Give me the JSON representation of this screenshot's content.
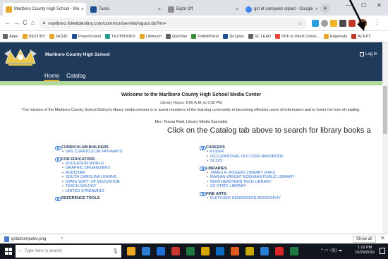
{
  "browser": {
    "tabs": [
      {
        "label": "Marlboro County High School - Ma",
        "color": "#e8a62a"
      },
      {
        "label": "Tasks",
        "color": "#1d4f91"
      },
      {
        "label": "Eight Off",
        "color": "#8e8e8e"
      },
      {
        "label": "girl at computer clipart - Google",
        "color": "#4285f4"
      }
    ],
    "tab_close": "×",
    "new_tab": "+",
    "window_controls": {
      "minimize": "—",
      "maximize": "☐",
      "close": "✕"
    },
    "nav": {
      "back": "←",
      "forward": "→",
      "reload": "C",
      "home": "⌂"
    },
    "url": "marlboro.follettdestiny.com/common/servlet/logout.do?lm=",
    "star": "☆",
    "menu": "⋮"
  },
  "bookmarks": [
    {
      "label": "Apps",
      "color": "#5f6368"
    },
    {
      "label": "DESTINY",
      "color": "#e8a62a"
    },
    {
      "label": "MCHS",
      "color": "#e8a62a"
    },
    {
      "label": "PowerSchool",
      "color": "#1d4f91"
    },
    {
      "label": "TEXTBOOKS",
      "color": "#2a9d8f"
    },
    {
      "label": "Lifetouch",
      "color": "#e8a62a"
    },
    {
      "label": "QuizStar",
      "color": "#5f6368"
    },
    {
      "label": "FollettPortal",
      "color": "#3a8d3a"
    },
    {
      "label": "1to1plus",
      "color": "#1d4f91"
    },
    {
      "label": "SC LEAD",
      "color": "#5f6368"
    },
    {
      "label": "PDF to Word Conve...",
      "color": "#e84a3a"
    },
    {
      "label": "Edgenuity",
      "color": "#e8a62a"
    },
    {
      "label": "ACEPT",
      "color": "#c0392b"
    }
  ],
  "site": {
    "name": "Marlboro County High School",
    "login": "Log In",
    "nav": [
      "Home",
      "Catalog"
    ]
  },
  "content": {
    "welcome": "Welcome to the Marlboro County High School Media Center",
    "hours": "Library Hours: 8:00 A.M. to 3:30 PM",
    "mission": "The mission of the Marlboro County School District's library media centers is to assist members of the learning community in becoming effective users of information and to foster the love of reading.",
    "specialist": "Mrs. Teresa Reid, Library Media Specialist",
    "cta": "Click on the Catalog tab above to search for library books a"
  },
  "sections_left": [
    {
      "title": "CURRICULUM BUILDERS",
      "items": [
        "SAS CURRICULUM PATHWAYS"
      ]
    },
    {
      "title": "FOR EDUCATORS",
      "items": [
        "EDUCATION WORLD",
        "GRAPHIC ORGANIZERS",
        "RUBISTAR",
        "SOUTH CAROLINA LEARNS",
        "STATE DEPT. OF EDUCATION",
        "TEACH.NOLOGY",
        "UNITED STREAMING"
      ]
    },
    {
      "title": "REFERENCE TOOLS",
      "items": []
    }
  ],
  "sections_right": [
    {
      "title": "CAREERS",
      "items": [
        "KUDER",
        "OCCUPATIONAL OUTLOOK HANDBOOK",
        "SCOIS"
      ]
    },
    {
      "title": "LIBRARIES",
      "items": [
        "JAMES A. ROGERS LIBRARY (FMU)",
        "MARIAN WRIGHT EDELMAN PUBLIC LIBRARY",
        "NORTHEASTERN TECH LIBRARY",
        "SC STATE LIBRARY"
      ]
    },
    {
      "title": "FINE ARTS",
      "items": [
        "FLETCHER HENDERSON BIOGRAPHY"
      ]
    }
  ],
  "downloads": {
    "file": "girlatcomputer.png",
    "chevron": "^",
    "show_all": "Show all",
    "close": "✕"
  },
  "taskbar": {
    "search_placeholder": "Type here to search",
    "apps": [
      "#f0a820",
      "#2b7cd3",
      "#1e6fd9",
      "#c8372d",
      "#1f7a3f",
      "#d6a800",
      "#0a6bc1",
      "#e05a1c",
      "#c6a800",
      "#2b7cd3",
      "#d7262a",
      "#1f7a3f"
    ],
    "time": "1:12 PM",
    "date": "10/29/2019"
  },
  "colors": {
    "header": "#203a5c",
    "nav_underline": "#e8a62a",
    "green_band": "#b2d89a",
    "link": "#2a6fd6"
  }
}
